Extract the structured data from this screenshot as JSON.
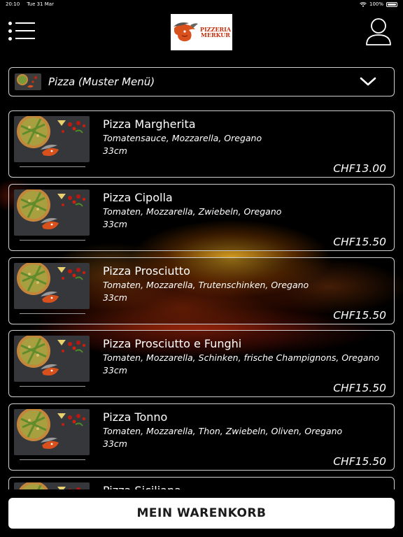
{
  "status_bar": {
    "time": "20:10",
    "date": "Tue 31 Mar",
    "battery": "100%"
  },
  "header": {
    "logo_line1": "PIZZERIA",
    "logo_line2": "MERKUR"
  },
  "category": {
    "title": "Pizza (Muster Menü)"
  },
  "items": [
    {
      "name": "Pizza Margherita",
      "desc": "Tomatensauce, Mozzarella, Oregano",
      "size": "33cm",
      "price": "CHF13.00"
    },
    {
      "name": "Pizza Cipolla",
      "desc": "Tomaten, Mozzarella, Zwiebeln, Oregano",
      "size": "33cm",
      "price": "CHF15.50"
    },
    {
      "name": "Pizza Prosciutto",
      "desc": "Tomaten, Mozzarella, Trutenschinken, Oregano",
      "size": "33cm",
      "price": "CHF15.50"
    },
    {
      "name": "Pizza Prosciutto e Funghi",
      "desc": "Tomaten, Mozzarella, Schinken, frische Champignons, Oregano",
      "size": "33cm",
      "price": "CHF15.50"
    },
    {
      "name": "Pizza Tonno",
      "desc": "Tomaten, Mozzarella, Thon, Zwiebeln, Oliven, Oregano",
      "size": "33cm",
      "price": "CHF15.50"
    },
    {
      "name": "Pizza Siciliana",
      "desc": "",
      "size": "",
      "price": ""
    }
  ],
  "cart": {
    "label": "MEIN WARENKORB"
  },
  "colors": {
    "background": "#000000",
    "border": "#cfcfcf",
    "logo_red": "#c43010"
  }
}
